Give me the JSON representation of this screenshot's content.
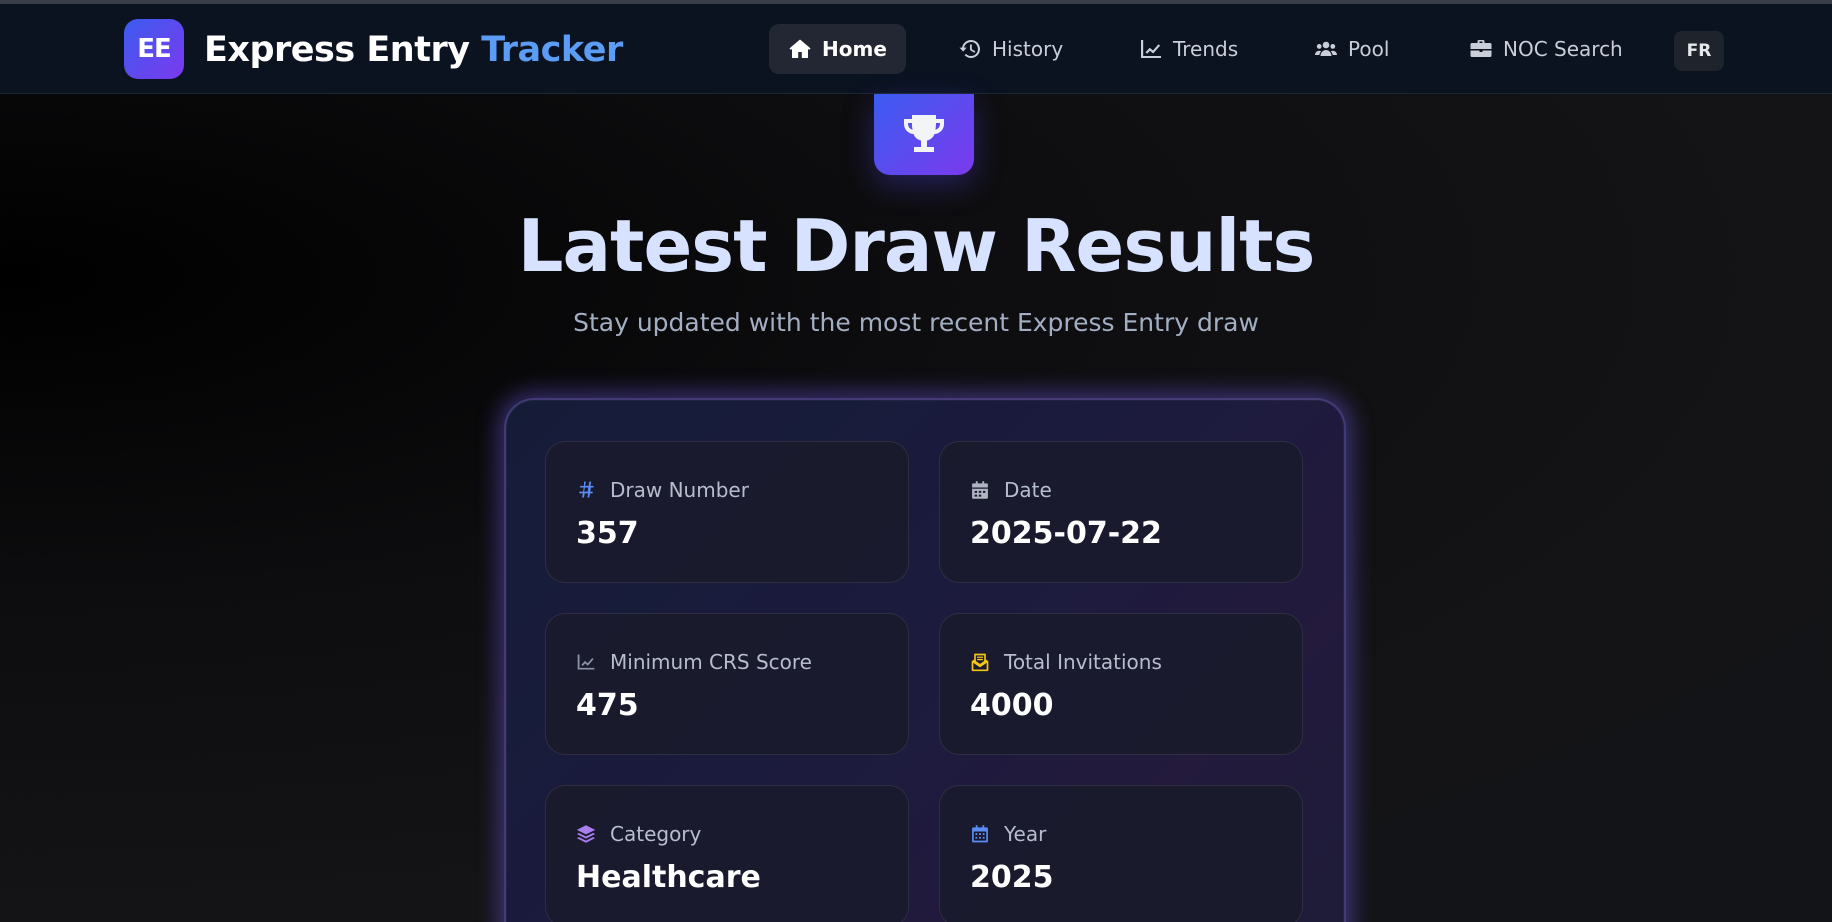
{
  "brand": {
    "badge": "EE",
    "name_part1": "Express Entry",
    "name_part2": "Tracker"
  },
  "nav": {
    "items": [
      {
        "label": "Home",
        "icon": "home-icon",
        "active": true
      },
      {
        "label": "History",
        "icon": "history-icon",
        "active": false
      },
      {
        "label": "Trends",
        "icon": "chart-line-icon",
        "active": false
      },
      {
        "label": "Pool",
        "icon": "users-icon",
        "active": false
      },
      {
        "label": "NOC Search",
        "icon": "briefcase-icon",
        "active": false
      }
    ],
    "language": "FR"
  },
  "hero": {
    "icon": "trophy-icon",
    "title": "Latest Draw Results",
    "subtitle": "Stay updated with the most recent Express Entry draw"
  },
  "cards": [
    {
      "label": "Draw Number",
      "value": "357",
      "icon": "hashtag-icon",
      "icon_color": "#5b8df5"
    },
    {
      "label": "Date",
      "value": "2025-07-22",
      "icon": "calendar-icon",
      "icon_color": "#aeb4c2"
    },
    {
      "label": "Minimum CRS Score",
      "value": "475",
      "icon": "chart-line-icon",
      "icon_color": "#8a92a3"
    },
    {
      "label": "Total Invitations",
      "value": "4000",
      "icon": "envelope-open-icon",
      "icon_color": "#f5c518"
    },
    {
      "label": "Category",
      "value": "Healthcare",
      "icon": "layer-group-icon",
      "icon_color": "#a97ff0"
    },
    {
      "label": "Year",
      "value": "2025",
      "icon": "calendar-days-icon",
      "icon_color": "#5b8df5"
    }
  ],
  "colors": {
    "accent_blue": "#5b9cf5",
    "gradient_start": "#3b5cf0",
    "gradient_end": "#7c3aed",
    "navbar_bg": "#0b1220"
  }
}
